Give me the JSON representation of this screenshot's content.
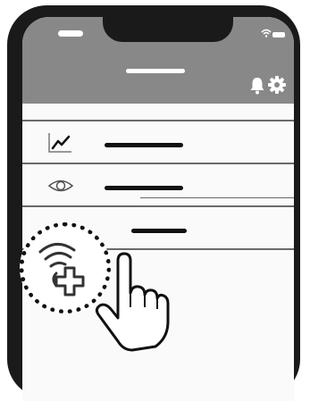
{
  "app": {
    "status_bar": {
      "icons": [
        "wifi-icon",
        "battery-icon"
      ]
    },
    "header": {
      "icons": [
        "bell-icon",
        "gear-icon"
      ]
    },
    "list": {
      "items": [
        {
          "icon": "trend-chart-icon"
        },
        {
          "icon": "eye-icon"
        },
        {
          "icon": "nfc-add-icon"
        }
      ]
    }
  },
  "colors": {
    "header": "#888888",
    "screen": "#fafafa",
    "frame": "#1a1a1a",
    "divider": "#6a6a6a"
  }
}
